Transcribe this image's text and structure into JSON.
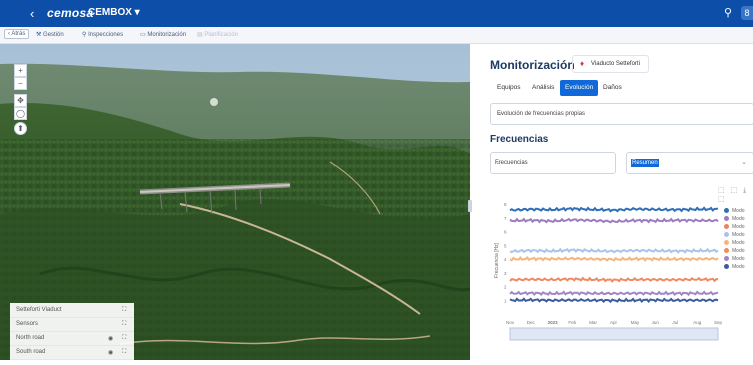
{
  "header": {
    "back_arrow": "‹",
    "logo": "cemosa",
    "app_name": "CEMBOX ▾",
    "search_icon": "search-icon",
    "user_initial": "8"
  },
  "nav": {
    "atras": "‹ Atrás",
    "items": [
      "Gestión",
      "Inspecciones",
      "Monitorización",
      "Planificación"
    ]
  },
  "map": {
    "controls": [
      "+",
      "−",
      "✥",
      "◯"
    ],
    "layers": [
      {
        "label": "Setteforti Viaduct"
      },
      {
        "label": "Sensors"
      },
      {
        "label": "North road"
      },
      {
        "label": "South road"
      }
    ]
  },
  "panel": {
    "title": "Monitorización",
    "location_chip": "Viaducto Setteforti",
    "tabs": [
      "Equipos",
      "Análisis",
      "Evolución",
      "Daños"
    ],
    "active_tab_index": 2,
    "analysis_select": "Evolución de frecuencias propias",
    "section_title": "Frecuencias",
    "variable_select": "Frecuencias",
    "mode_select": "Resumen",
    "toolbar_icons": "⬚ ⬚ ⤓ ⬚"
  },
  "chart_data": {
    "type": "line",
    "title": "",
    "ylabel": "Frecuencia [Hz]",
    "xlabel": "",
    "ylim": [
      0,
      8
    ],
    "yticks": [
      1,
      2,
      3,
      4,
      5,
      6,
      7,
      8
    ],
    "xticks": [
      "Nov",
      "Dec",
      "2023",
      "Feb",
      "Mar",
      "Apr",
      "May",
      "Jun",
      "Jul",
      "Aug",
      "Sep"
    ],
    "grid": false,
    "legend_position": "right",
    "series": [
      {
        "name": "Modo",
        "color": "#2e6fb5",
        "base": 7.6,
        "values": [
          7.55,
          7.62,
          7.58,
          7.66,
          7.6,
          7.55,
          7.64,
          7.6,
          7.58,
          7.62,
          7.63
        ]
      },
      {
        "name": "Modo",
        "color": "#9b7cc0",
        "base": 6.8,
        "values": [
          6.78,
          6.82,
          6.75,
          6.85,
          6.8,
          6.72,
          6.8,
          6.78,
          6.82,
          6.8,
          6.79
        ]
      },
      {
        "name": "Modo",
        "color": "#e9855d",
        "base": 6.5,
        "values": []
      },
      {
        "name": "Modo",
        "color": "#a9c4e8",
        "base": 4.6,
        "values": [
          4.55,
          4.62,
          4.58,
          4.65,
          4.6,
          4.56,
          4.62,
          4.6,
          4.58,
          4.6,
          4.61
        ]
      },
      {
        "name": "Modo",
        "color": "#f4b57a",
        "base": 4.0,
        "values": [
          3.98,
          4.02,
          4.0,
          4.03,
          4.0,
          3.97,
          4.01,
          4.0,
          3.99,
          4.0,
          4.02
        ]
      },
      {
        "name": "Modo",
        "color": "#f08a60",
        "base": 2.5,
        "values": [
          2.48,
          2.52,
          2.5,
          2.54,
          2.5,
          2.47,
          2.51,
          2.5,
          2.49,
          2.52,
          2.5
        ]
      },
      {
        "name": "Modo",
        "color": "#9f86c6",
        "base": 1.5,
        "values": [
          1.5,
          1.52,
          1.48,
          1.53,
          1.5,
          1.49,
          1.51,
          1.5,
          1.5,
          1.51,
          1.5
        ]
      },
      {
        "name": "Modo",
        "color": "#3b5d9c",
        "base": 1.0,
        "values": [
          1.0,
          1.02,
          0.99,
          1.01,
          1.0,
          0.98,
          1.0,
          1.01,
          1.0,
          1.0,
          1.0
        ]
      }
    ]
  }
}
